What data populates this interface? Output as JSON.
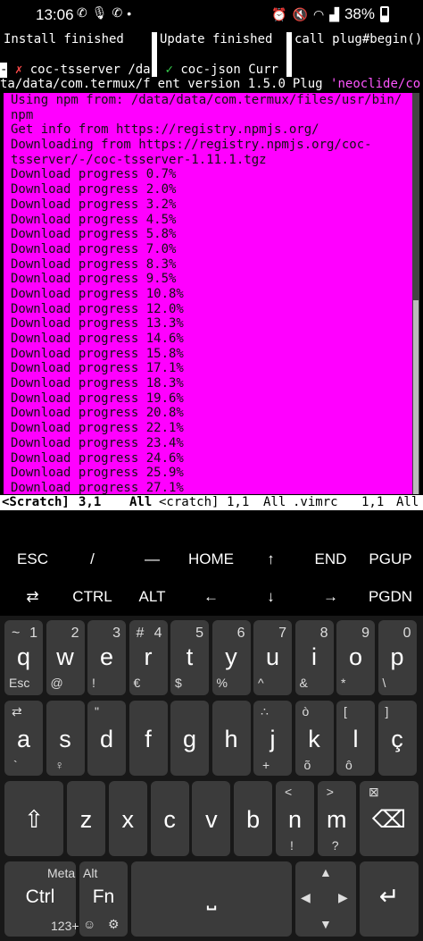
{
  "status_bar": {
    "time": "13:06",
    "battery": "38%",
    "left_icons": [
      "whatsapp-icon",
      "mic-icon",
      "whatsapp-icon",
      "dot-icon"
    ],
    "right_icons": [
      "alarm-icon",
      "mute-icon",
      "wifi-icon",
      "signal-icon",
      "battery-icon"
    ]
  },
  "terminal": {
    "tabs": [
      "Install finished",
      "Update finished",
      "call plug#begin()"
    ],
    "row2": {
      "dash": "-",
      "fail_mark": "✗",
      "item1": " coc-tsserver /da",
      "sep": "-",
      "ok_mark": "✓",
      "item2": " coc-json Curr"
    },
    "row3": {
      "part1": "ta/data/com.termux/f",
      "part2": "ent version 1.5.0",
      "part3": "Plug ",
      "part4": "'neoclide/co"
    },
    "scratch_lines": [
      "Using npm from: /data/data/com.termux/files/usr/bin/",
      "npm",
      "Get info from https://registry.npmjs.org/",
      "Downloading from https://registry.npmjs.org/coc-",
      "tsserver/-/coc-tsserver-1.11.1.tgz",
      "Download progress 0.7%",
      "Download progress 2.0%",
      "Download progress 3.2%",
      "Download progress 4.5%",
      "Download progress 5.8%",
      "Download progress 7.0%",
      "Download progress 8.3%",
      "Download progress 9.5%",
      "Download progress 10.8%",
      "Download progress 12.0%",
      "Download progress 13.3%",
      "Download progress 14.6%",
      "Download progress 15.8%",
      "Download progress 17.1%",
      "Download progress 18.3%",
      "Download progress 19.6%",
      "Download progress 20.8%",
      "Download progress 22.1%",
      "Download progress 23.4%",
      "Download progress 24.6%",
      "Download progress 25.9%",
      "Download progress 27.1%"
    ],
    "statusline": {
      "pane1_name": "<Scratch]",
      "pane1_pos": "3,1",
      "pane1_all": "All",
      "pane2_name": "<cratch]",
      "pane2_pos": "1,1",
      "pane2_all": "All",
      "pane3_name": ".vimrc",
      "pane3_pos": "1,1",
      "pane3_all": "All"
    }
  },
  "extra_keys": {
    "row1": [
      "ESC",
      "/",
      "—",
      "HOME",
      "↑",
      "END",
      "PGUP"
    ],
    "row2": [
      "⇄",
      "CTRL",
      "ALT",
      "←",
      "↓",
      "→",
      "PGDN"
    ]
  },
  "keyboard": {
    "row1": [
      {
        "main": "q",
        "num": "1",
        "alt": "~",
        "sub": "Esc"
      },
      {
        "main": "w",
        "num": "2",
        "alt": "",
        "sub": "@"
      },
      {
        "main": "e",
        "num": "3",
        "alt": "",
        "sub": "!"
      },
      {
        "main": "r",
        "num": "4",
        "alt": "#",
        "sub": "€"
      },
      {
        "main": "t",
        "num": "5",
        "alt": "",
        "sub": "$"
      },
      {
        "main": "y",
        "num": "6",
        "alt": "",
        "sub": "%"
      },
      {
        "main": "u",
        "num": "7",
        "alt": "",
        "sub": "^"
      },
      {
        "main": "i",
        "num": "8",
        "alt": "",
        "sub": "&"
      },
      {
        "main": "o",
        "num": "9",
        "alt": "",
        "sub": "*"
      },
      {
        "main": "p",
        "num": "0",
        "alt": "",
        "sub": "\\"
      }
    ],
    "row1_extra": {
      "key6_sub2": "ö",
      "key9_sub2": "õ"
    },
    "row2": [
      {
        "main": "a",
        "top": "⇄",
        "bottom": "`"
      },
      {
        "main": "s",
        "top": "",
        "bottom": "♀"
      },
      {
        "main": "d",
        "top": "\"",
        "bottom": ""
      },
      {
        "main": "f",
        "top": "",
        "bottom": ""
      },
      {
        "main": "g",
        "top": "",
        "bottom": ""
      },
      {
        "main": "h",
        "top": "",
        "bottom": ""
      },
      {
        "main": "j",
        "top": "∴",
        "bottom": "+"
      },
      {
        "main": "k",
        "top": "ò",
        "bottom": "õ"
      },
      {
        "main": "l",
        "top": "[",
        "bottom": "ô"
      },
      {
        "main": "ç",
        "top": "]",
        "bottom": ""
      }
    ],
    "row3": [
      {
        "main": "⇧",
        "top": ""
      },
      {
        "main": "z",
        "top": ""
      },
      {
        "main": "x",
        "top": ""
      },
      {
        "main": "c",
        "top": ""
      },
      {
        "main": "v",
        "top": ""
      },
      {
        "main": "b",
        "top": ""
      },
      {
        "main": "n",
        "top": "<"
      },
      {
        "main": "m",
        "top": ">"
      },
      {
        "main": "⌫",
        "top": "⊠"
      }
    ],
    "row3_sub": {
      "n_bottom": "!",
      "m_bottom": "?"
    },
    "row4": {
      "ctrl": "Ctrl",
      "ctrl_top": "Meta",
      "ctrl_bottom": "123+",
      "fn": "Fn",
      "fn_top": "Alt",
      "space": "⎵",
      "arrows_up": "▲",
      "arrows_left": "◀",
      "arrows_right": "▶",
      "arrows_down": "▼",
      "enter": "↵"
    }
  }
}
